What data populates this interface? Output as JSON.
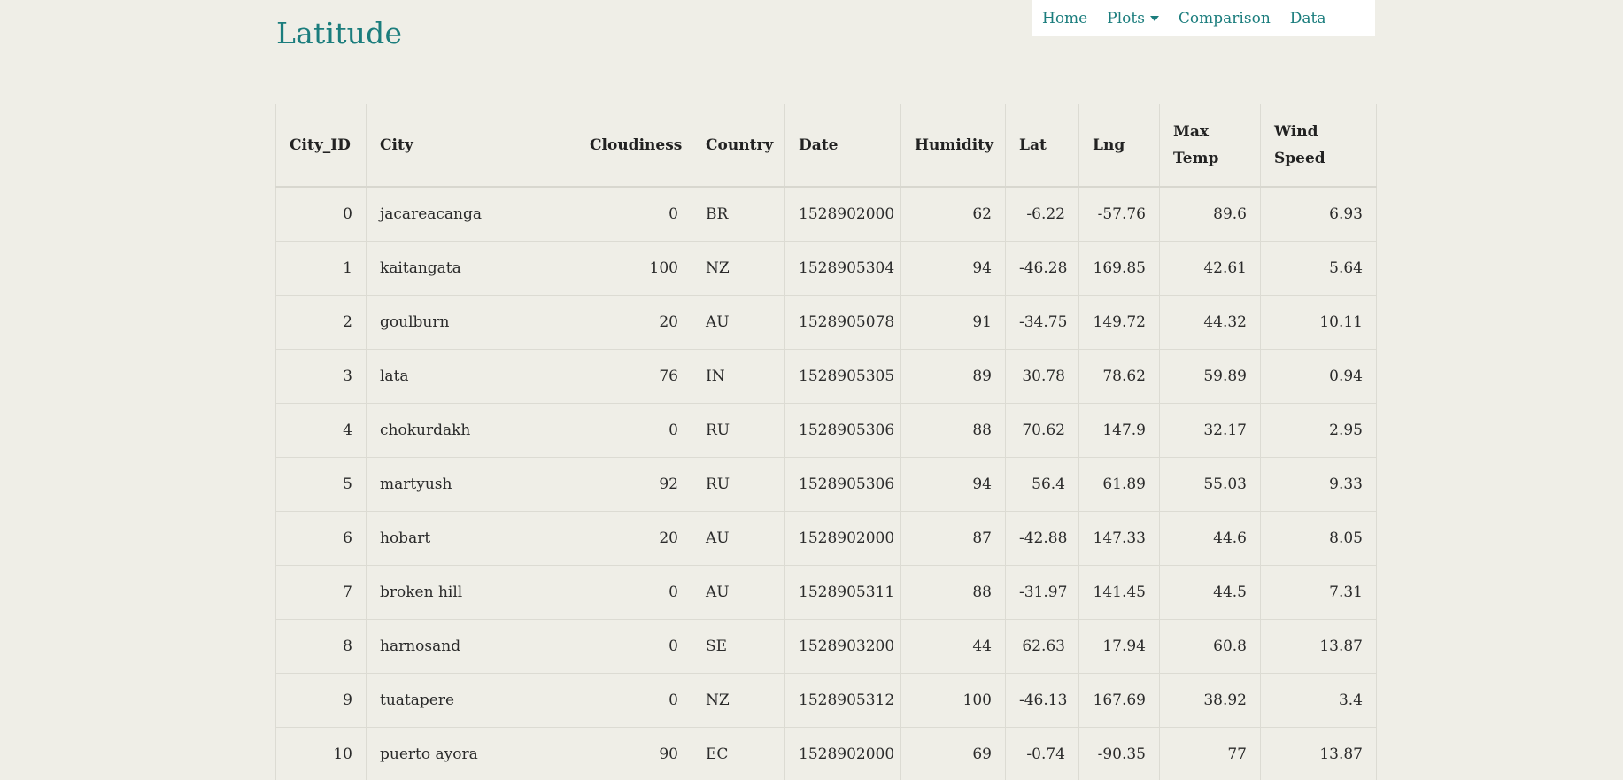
{
  "page_title": "Latitude",
  "nav": {
    "items": [
      {
        "label": "Home"
      },
      {
        "label": "Plots"
      },
      {
        "label": "Comparison"
      },
      {
        "label": "Data"
      }
    ]
  },
  "table": {
    "headers": [
      "City_ID",
      "City",
      "Cloudiness",
      "Country",
      "Date",
      "Humidity",
      "Lat",
      "Lng",
      "Max Temp",
      "Wind Speed"
    ],
    "rows": [
      [
        "0",
        "jacareacanga",
        "0",
        "BR",
        "1528902000",
        "62",
        "-6.22",
        "-57.76",
        "89.6",
        "6.93"
      ],
      [
        "1",
        "kaitangata",
        "100",
        "NZ",
        "1528905304",
        "94",
        "-46.28",
        "169.85",
        "42.61",
        "5.64"
      ],
      [
        "2",
        "goulburn",
        "20",
        "AU",
        "1528905078",
        "91",
        "-34.75",
        "149.72",
        "44.32",
        "10.11"
      ],
      [
        "3",
        "lata",
        "76",
        "IN",
        "1528905305",
        "89",
        "30.78",
        "78.62",
        "59.89",
        "0.94"
      ],
      [
        "4",
        "chokurdakh",
        "0",
        "RU",
        "1528905306",
        "88",
        "70.62",
        "147.9",
        "32.17",
        "2.95"
      ],
      [
        "5",
        "martyush",
        "92",
        "RU",
        "1528905306",
        "94",
        "56.4",
        "61.89",
        "55.03",
        "9.33"
      ],
      [
        "6",
        "hobart",
        "20",
        "AU",
        "1528902000",
        "87",
        "-42.88",
        "147.33",
        "44.6",
        "8.05"
      ],
      [
        "7",
        "broken hill",
        "0",
        "AU",
        "1528905311",
        "88",
        "-31.97",
        "141.45",
        "44.5",
        "7.31"
      ],
      [
        "8",
        "harnosand",
        "0",
        "SE",
        "1528903200",
        "44",
        "62.63",
        "17.94",
        "60.8",
        "13.87"
      ],
      [
        "9",
        "tuatapere",
        "0",
        "NZ",
        "1528905312",
        "100",
        "-46.13",
        "167.69",
        "38.92",
        "3.4"
      ],
      [
        "10",
        "puerto ayora",
        "90",
        "EC",
        "1528902000",
        "69",
        "-0.74",
        "-90.35",
        "77",
        "13.87"
      ]
    ]
  },
  "colors": {
    "accent": "#1b7d7d",
    "background": "#efeee7",
    "nav_background": "#ffffff"
  }
}
